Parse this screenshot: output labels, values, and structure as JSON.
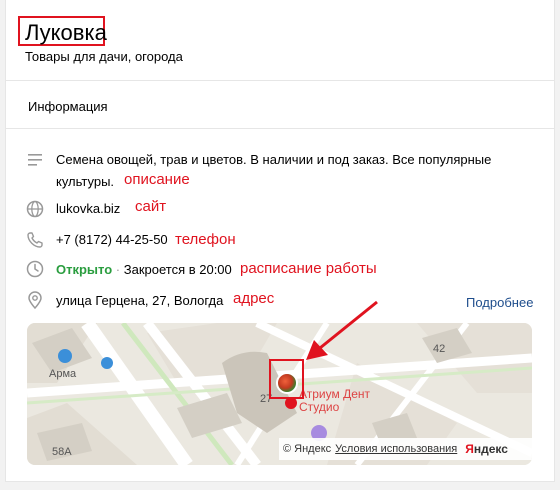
{
  "header": {
    "title": "Луковка",
    "subtitle": "Товары для дачи, огорода"
  },
  "section": {
    "title": "Информация"
  },
  "rows": {
    "description": {
      "text_line1": "Семена овощей, трав и цветов. В наличии и под заказ. Все популярные",
      "text_line2": "культуры.",
      "annotation": "описание"
    },
    "website": {
      "text": "lukovka.biz",
      "annotation": "сайт"
    },
    "phone": {
      "text": "+7 (8172) 44-25-50",
      "annotation": "телефон"
    },
    "hours": {
      "status": "Открыто",
      "separator": " · ",
      "closes": "Закроется в 20:00",
      "annotation": "расписание работы"
    },
    "address": {
      "text": "улица Герцена, 27, Вологда",
      "annotation": "адрес",
      "more_link": "Подробнее"
    }
  },
  "map": {
    "labels": {
      "arma": "Арма",
      "building_42": "42",
      "building_58a": "58А",
      "building_27": "27",
      "poi_line1": "Атриум Дент",
      "poi_line2": "Студио"
    },
    "copyright": "© Яндекс",
    "terms_link": "Условия использования",
    "brand_first": "Я",
    "brand_rest": "ндекс"
  },
  "colors": {
    "annotation_red": "#e0131f",
    "open_green": "#2a9d3f",
    "link_blue": "#1e4d8c"
  }
}
